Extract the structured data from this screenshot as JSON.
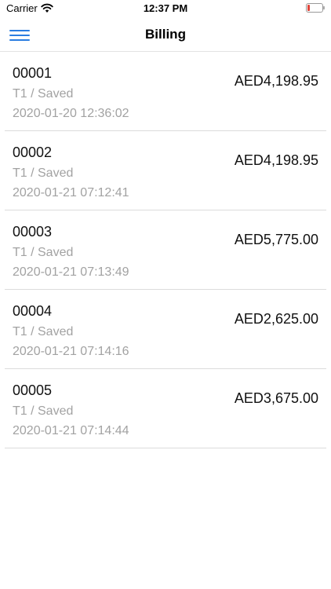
{
  "status_bar": {
    "carrier": "Carrier",
    "time": "12:37 PM",
    "wifi_icon": "wifi-icon",
    "battery_icon": "battery-low-icon",
    "battery_color": "#e0453a"
  },
  "nav": {
    "title": "Billing",
    "menu_icon": "hamburger-menu-icon",
    "accent_color": "#2a7de1"
  },
  "bills": [
    {
      "id": "00001",
      "status": "T1 / Saved",
      "date": "2020-01-20 12:36:02",
      "amount": "AED4,198.95"
    },
    {
      "id": "00002",
      "status": "T1 / Saved",
      "date": "2020-01-21 07:12:41",
      "amount": "AED4,198.95"
    },
    {
      "id": "00003",
      "status": "T1 / Saved",
      "date": "2020-01-21 07:13:49",
      "amount": "AED5,775.00"
    },
    {
      "id": "00004",
      "status": "T1 / Saved",
      "date": "2020-01-21 07:14:16",
      "amount": "AED2,625.00"
    },
    {
      "id": "00005",
      "status": "T1 / Saved",
      "date": "2020-01-21 07:14:44",
      "amount": "AED3,675.00"
    }
  ]
}
